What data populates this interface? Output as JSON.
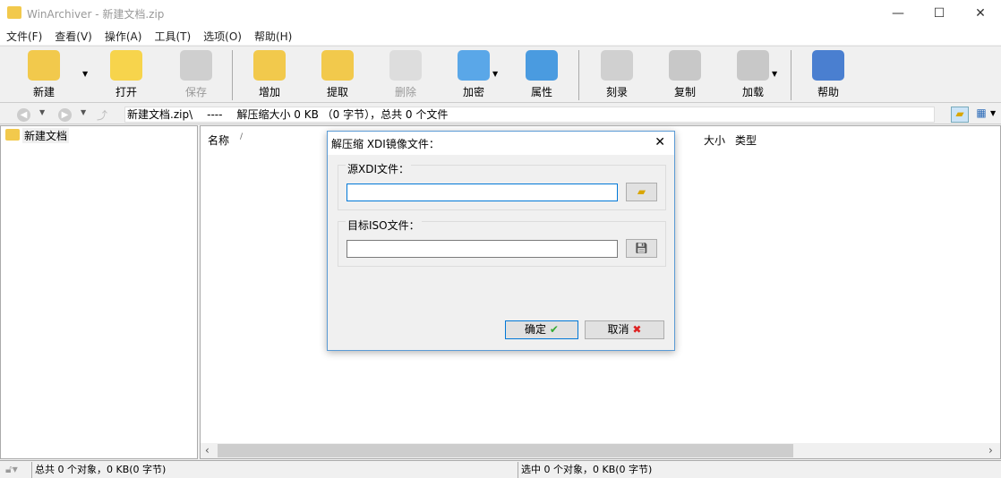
{
  "window": {
    "title": "WinArchiver - 新建文档.zip",
    "min": "—",
    "max": "☐",
    "close": "✕"
  },
  "menu": [
    "文件(F)",
    "查看(V)",
    "操作(A)",
    "工具(T)",
    "选项(O)",
    "帮助(H)"
  ],
  "toolbar": [
    {
      "label": "新建",
      "disabled": false,
      "color": "#f2c94c"
    },
    {
      "label": "打开",
      "disabled": false,
      "color": "#f7d44c"
    },
    {
      "label": "保存",
      "disabled": true,
      "color": "#cfcfcf"
    },
    {
      "label": "增加",
      "disabled": false,
      "color": "#f2c94c"
    },
    {
      "label": "提取",
      "disabled": false,
      "color": "#f2c94c"
    },
    {
      "label": "删除",
      "disabled": true,
      "color": "#dddddd"
    },
    {
      "label": "加密",
      "disabled": false,
      "color": "#5aa7e8"
    },
    {
      "label": "属性",
      "disabled": false,
      "color": "#4a9be0"
    },
    {
      "label": "刻录",
      "disabled": false,
      "color": "#d0d0d0"
    },
    {
      "label": "复制",
      "disabled": false,
      "color": "#c8c8c8"
    },
    {
      "label": "加载",
      "disabled": false,
      "color": "#c8c8c8"
    },
    {
      "label": "帮助",
      "disabled": false,
      "color": "#4a7fd0"
    }
  ],
  "address": {
    "path": "新建文档.zip\\",
    "dash": "----",
    "info": "解压缩大小 0 KB （0 字节），总共 0 个文件"
  },
  "tree": {
    "root": "新建文档"
  },
  "columns": {
    "name": "名称",
    "sort": "/",
    "size": "大小",
    "type": "类型"
  },
  "status": {
    "total": "总共 0 个对象，0 KB(0 字节)",
    "selected": "选中 0 个对象，0 KB(0 字节)"
  },
  "dialog": {
    "title": "解压缩 XDI镜像文件：",
    "source_label": "源XDI文件：",
    "source_value": "",
    "target_label": "目标ISO文件：",
    "target_value": "",
    "ok": "确定",
    "cancel": "取消"
  }
}
